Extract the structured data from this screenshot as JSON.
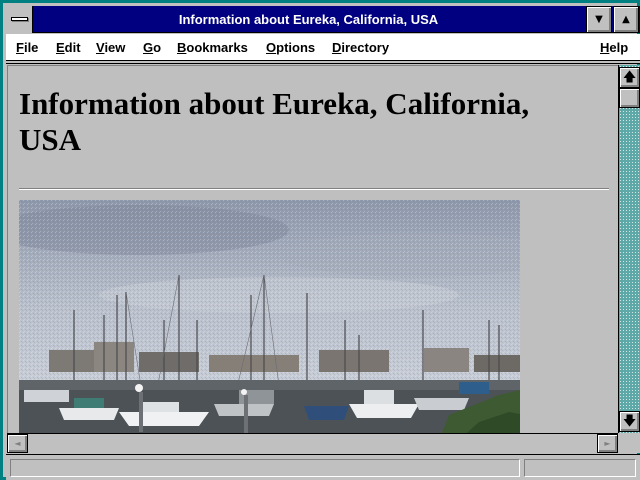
{
  "window": {
    "title": "Information about Eureka, California, USA",
    "minimize_glyph": "▼",
    "maximize_glyph": "▲"
  },
  "menu": {
    "items": [
      {
        "key": "F",
        "rest": "ile"
      },
      {
        "key": "E",
        "rest": "dit"
      },
      {
        "key": "V",
        "rest": "iew"
      },
      {
        "key": "G",
        "rest": "o"
      },
      {
        "key": "B",
        "rest": "ookmarks"
      },
      {
        "key": "O",
        "rest": "ptions"
      },
      {
        "key": "D",
        "rest": "irectory"
      }
    ],
    "help": {
      "key": "H",
      "rest": "elp"
    }
  },
  "page": {
    "heading": "Information about Eureka, California, USA",
    "image_description_icon": "harbor-photo"
  },
  "scrollbars": {
    "up_glyph": "🡅",
    "down_glyph": "🡇",
    "left_glyph": "◄",
    "right_glyph": "►"
  },
  "status": {
    "message": ""
  }
}
